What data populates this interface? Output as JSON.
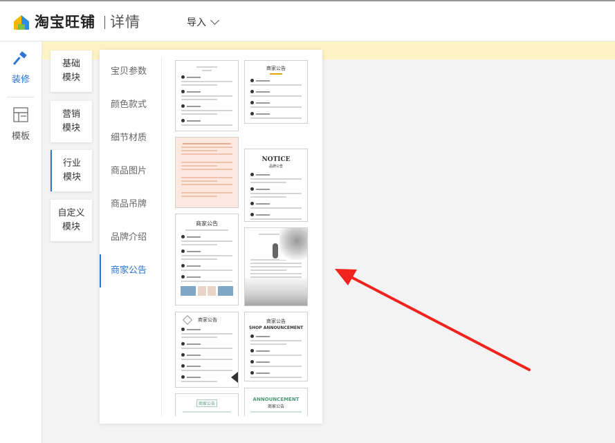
{
  "header": {
    "brand": "淘宝旺铺",
    "subtitle": "详情",
    "import_label": "导入"
  },
  "rail": {
    "items": [
      {
        "label": "装修",
        "icon": "hammer-icon",
        "active": true
      },
      {
        "label": "模板",
        "icon": "layout-template-icon",
        "active": false
      }
    ]
  },
  "modules": [
    {
      "label": "基础\n模块"
    },
    {
      "label": "营销\n模块"
    },
    {
      "label": "行业\n模块",
      "active": true
    },
    {
      "label": "自定义\n模块"
    }
  ],
  "categories": [
    {
      "label": "宝贝参数"
    },
    {
      "label": "颜色款式"
    },
    {
      "label": "细节材质"
    },
    {
      "label": "商品图片"
    },
    {
      "label": "商品吊牌"
    },
    {
      "label": "品牌介绍"
    },
    {
      "label": "商家公告",
      "active": true
    }
  ],
  "thumbnails": {
    "t2_title": "商家公告",
    "t4_title": "NOTICE",
    "t4_sub": "品牌公告",
    "t5_title": "商家公告",
    "t7_title": "商家公告",
    "t8_title": "商家公告",
    "t8_sub": "SHOP ANNOUNCEMENT",
    "t9_title": "商家公告",
    "t10_title": "ANNOUNCEMENT",
    "t10_sub": "商家公告"
  },
  "colors": {
    "accent": "#2e74d6",
    "notice_bar": "#fdf2c4",
    "arrow": "#f2231c"
  }
}
